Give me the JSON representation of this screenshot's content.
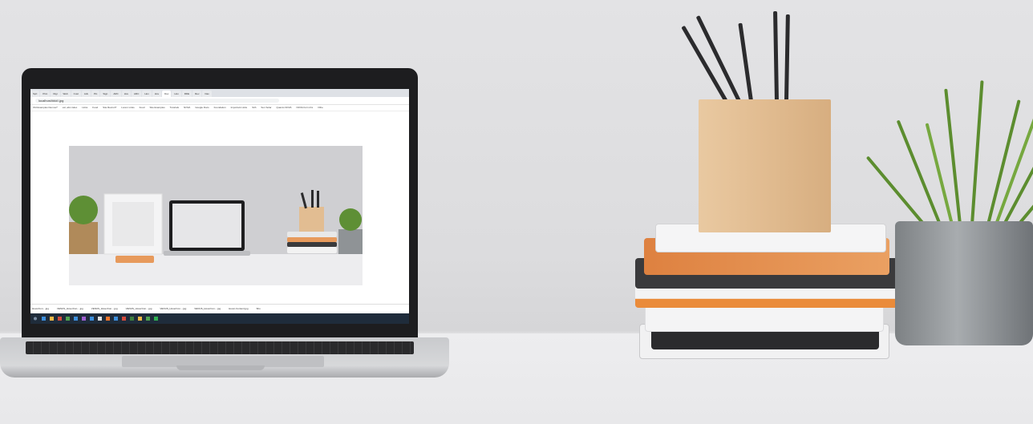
{
  "screen": {
    "tabs": [
      "Spri",
      "Pinn",
      "Digi",
      "Web",
      "Cust",
      "Adv",
      "Pin",
      "Sign",
      "ARC",
      "Hov",
      "ARC",
      "Hov",
      "Hov",
      "Dov",
      "Hov",
      "RDE",
      "Rev",
      "Dav"
    ],
    "url": "localhost/###/-jpg",
    "bookmarks": [
      "Old Examples Demos?",
      "var, abc.index",
      "Links",
      "Food",
      "Site Recruit?",
      "Lorem Links",
      "Food",
      "Site Examples",
      "Tutorials",
      "NOVA",
      "Google Docs",
      "Foundation",
      "Important Links",
      "Sith",
      "Sun Solar",
      "Quanto NOVA",
      "NOVA Form Fix",
      "Othe"
    ],
    "downloads": [
      "HoverCon....jpg",
      "VENUS_HoverCon....jpg",
      "VENUS_HoverCon....jpg",
      "VENUS_HoverCon....jpg",
      "VENUS_HoverCon....jpg",
      "VENUS_HoverCon....jpg",
      "Hover-Content.jpg",
      "Sho"
    ]
  },
  "colors": {
    "wall": "#e0e0e2",
    "desk": "#ececee",
    "wood": "#e2bd92",
    "plant": "#5c8d2f",
    "pot": "#8f9396"
  }
}
